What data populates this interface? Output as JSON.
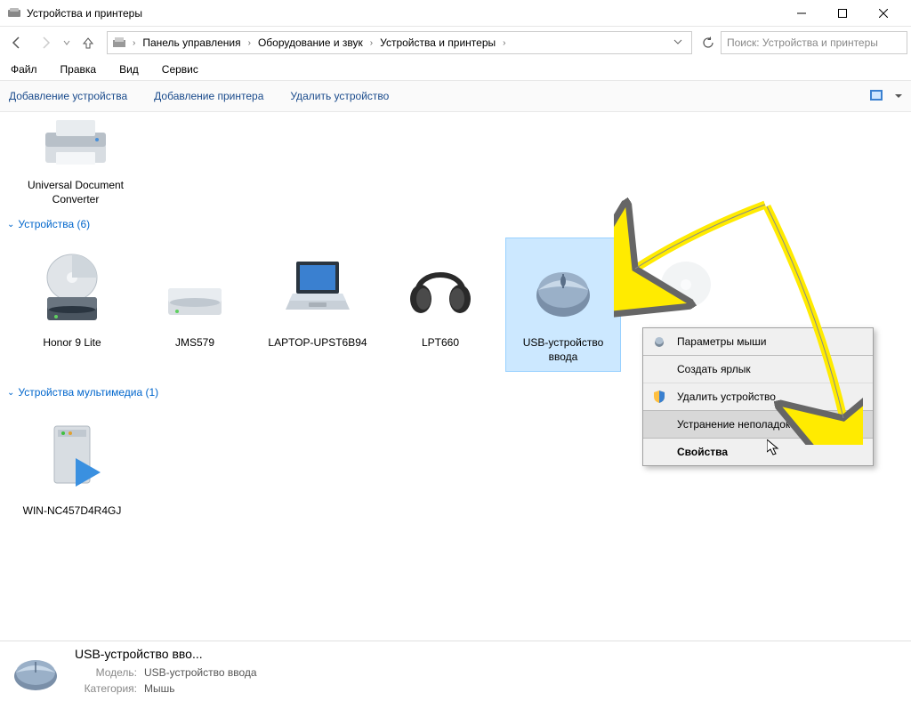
{
  "window": {
    "title": "Устройства и принтеры"
  },
  "breadcrumb": {
    "items": [
      "Панель управления",
      "Оборудование и звук",
      "Устройства и принтеры"
    ]
  },
  "search": {
    "placeholder": "Поиск: Устройства и принтеры"
  },
  "menu": {
    "file": "Файл",
    "edit": "Правка",
    "view": "Вид",
    "tools": "Сервис"
  },
  "toolbar": {
    "add_device": "Добавление устройства",
    "add_printer": "Добавление принтера",
    "remove_device": "Удалить устройство"
  },
  "groups": {
    "printers_top_item": "Universal Document Converter",
    "devices_header": "Устройства (6)",
    "multimedia_header": "Устройства мультимедиа (1)"
  },
  "devices": [
    {
      "label": "Honor 9 Lite"
    },
    {
      "label": "JMS579"
    },
    {
      "label": "LAPTOP-UPST6B94"
    },
    {
      "label": "LPT660"
    },
    {
      "label": "USB-устройство ввода"
    }
  ],
  "multimedia": [
    {
      "label": "WIN-NC457D4R4GJ"
    }
  ],
  "context_menu": {
    "mouse_params": "Параметры мыши",
    "create_shortcut": "Создать ярлык",
    "remove_device": "Удалить устройство",
    "troubleshoot": "Устранение неполадок",
    "properties": "Свойства"
  },
  "details": {
    "title": "USB-устройство вво...",
    "model_label": "Модель:",
    "model_value": "USB-устройство ввода",
    "category_label": "Категория:",
    "category_value": "Мышь"
  }
}
